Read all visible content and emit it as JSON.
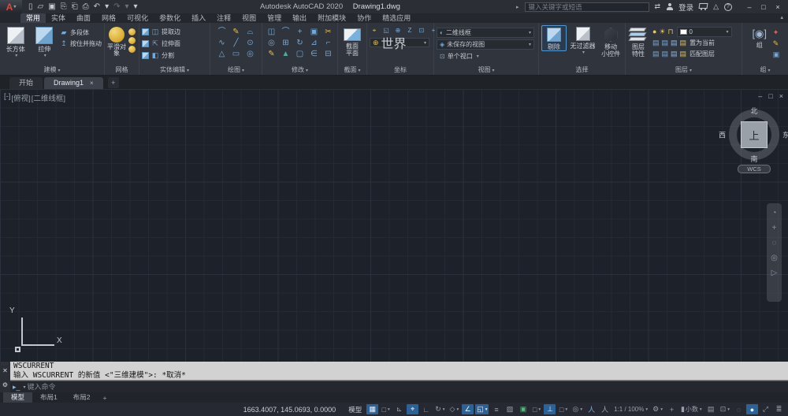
{
  "titlebar": {
    "logo_letter": "A",
    "app_title": "Autodesk AutoCAD 2020",
    "doc_title": "Drawing1.dwg",
    "search_expand": "▸",
    "search_placeholder": "键入关键字或短语",
    "exchange_glyph": "⇄",
    "signin_label": "登录",
    "triangle_glyph": "△",
    "help_glyph": "?",
    "win_min": "–",
    "win_max": "□",
    "win_close": "×",
    "qat": [
      {
        "name": "new",
        "glyph": "▯"
      },
      {
        "name": "open",
        "glyph": "▱"
      },
      {
        "name": "save",
        "glyph": "▣"
      },
      {
        "name": "save-as",
        "glyph": "⎘"
      },
      {
        "name": "plot-batch",
        "glyph": "⎗"
      },
      {
        "name": "plot",
        "glyph": "⎙"
      },
      {
        "name": "undo",
        "glyph": "↶"
      },
      {
        "name": "undo-dd",
        "glyph": "▾"
      },
      {
        "name": "redo",
        "glyph": "↷",
        "color": "#6b717b"
      },
      {
        "name": "redo-dd",
        "glyph": "▾",
        "color": "#6b717b"
      },
      {
        "name": "qat-customize",
        "glyph": "▾"
      }
    ]
  },
  "ribbon": {
    "tabs": [
      {
        "label": "常用",
        "active": true
      },
      {
        "label": "实体"
      },
      {
        "label": "曲面"
      },
      {
        "label": "网格"
      },
      {
        "label": "可视化"
      },
      {
        "label": "参数化"
      },
      {
        "label": "插入"
      },
      {
        "label": "注释"
      },
      {
        "label": "视图"
      },
      {
        "label": "管理"
      },
      {
        "label": "输出"
      },
      {
        "label": "附加模块"
      },
      {
        "label": "协作"
      },
      {
        "label": "精选应用"
      }
    ],
    "collapse_glyph": "▴"
  },
  "panels": {
    "modeling": {
      "label": "建模",
      "box": "长方体",
      "extrude": "拉伸",
      "polysolid": "多段体",
      "presspull": "按住并拖动"
    },
    "mesh": {
      "label": "网格",
      "smooth": "平滑对象"
    },
    "solid_edit": {
      "label": "实体编辑",
      "items": [
        {
          "glyph": "◫",
          "label": "提取边"
        },
        {
          "glyph": "⇱",
          "label": "拉伸面"
        },
        {
          "glyph": "◧",
          "label": "分割"
        }
      ]
    },
    "draw": {
      "label": "绘图",
      "icons": [
        {
          "name": "arc",
          "glyph": "⌒"
        },
        {
          "name": "pencil",
          "glyph": "✎",
          "color": "#e3bf4a"
        },
        {
          "name": "arc-chord",
          "glyph": "⌓"
        },
        {
          "name": "spline",
          "glyph": "∿"
        },
        {
          "name": "line",
          "glyph": "╱"
        },
        {
          "name": "circle",
          "glyph": "⊙"
        },
        {
          "name": "polygon",
          "glyph": "△"
        },
        {
          "name": "rectangle",
          "glyph": "▭"
        },
        {
          "name": "donut",
          "glyph": "◎"
        }
      ]
    },
    "modify": {
      "label": "修改",
      "icons": [
        {
          "name": "mirror",
          "glyph": "◫"
        },
        {
          "name": "fillet",
          "glyph": "⌒"
        },
        {
          "name": "move",
          "glyph": "+"
        },
        {
          "name": "copy",
          "glyph": "▣"
        },
        {
          "name": "trim",
          "glyph": "✂",
          "color": "#e3bf4a"
        },
        {
          "name": "offset",
          "glyph": "◎"
        },
        {
          "name": "array",
          "glyph": "⊞"
        },
        {
          "name": "rotate",
          "glyph": "↻"
        },
        {
          "name": "scale",
          "glyph": "⊿"
        },
        {
          "name": "stretch",
          "glyph": "⌐"
        },
        {
          "name": "erase",
          "glyph": "✎",
          "color": "#e3bf4a"
        },
        {
          "name": "explode",
          "glyph": "▲",
          "color": "#58a6a0"
        },
        {
          "name": "align",
          "glyph": "▢"
        },
        {
          "name": "join",
          "glyph": "∈"
        },
        {
          "name": "break",
          "glyph": "⊟"
        }
      ]
    },
    "section": {
      "label": "截面",
      "plane_line1": "截面",
      "plane_line2": "平面"
    },
    "coords": {
      "label": "坐标",
      "world": "世界",
      "icons": [
        {
          "name": "ucs",
          "glyph": "⌖",
          "color": "#e3bf4a"
        },
        {
          "name": "ucs-previous",
          "glyph": "◱"
        },
        {
          "name": "ucs-origin",
          "glyph": "⊕"
        },
        {
          "name": "ucs-z",
          "glyph": "Z"
        },
        {
          "name": "ucs-view",
          "glyph": "⊡"
        },
        {
          "name": "ucs-object",
          "glyph": "+"
        }
      ]
    },
    "view": {
      "label": "视图",
      "visual_style": "二维线框",
      "named_view": "未保存的视图",
      "viewport_cfg": "单个视口"
    },
    "selection": {
      "label": "选择",
      "cull": "剔除",
      "filter_line1": "无过滤器",
      "gizmo_line1": "移动",
      "gizmo_line2": "小控件"
    },
    "layers": {
      "label": "图层",
      "props_line1": "图层",
      "props_line2": "特性",
      "layer_name": "0",
      "set_current": "置为当前",
      "match": "匹配图层",
      "row1_icons": [
        {
          "name": "layer-on-bulb",
          "glyph": "●",
          "color": "#e8c94a"
        },
        {
          "name": "layer-thaw-sun",
          "glyph": "☀",
          "color": "#e8c94a"
        },
        {
          "name": "layer-unlock",
          "glyph": "⊓",
          "color": "#e8c94a"
        }
      ],
      "row2_icons": [
        {
          "name": "layer-off",
          "glyph": "▤",
          "color": "#74a9d8"
        },
        {
          "name": "layer-isolate",
          "glyph": "▤",
          "color": "#74a9d8"
        },
        {
          "name": "layer-freeze",
          "glyph": "▤",
          "color": "#8fb6dd"
        },
        {
          "name": "layer-lock",
          "glyph": "▤",
          "color": "#e3bf4a"
        }
      ],
      "row3_icons": [
        {
          "name": "layer-unisolate",
          "glyph": "▤",
          "color": "#74a9d8"
        },
        {
          "name": "layer-walk",
          "glyph": "▤",
          "color": "#74a9d8"
        },
        {
          "name": "layer-prev",
          "glyph": "▤",
          "color": "#8fb6dd"
        },
        {
          "name": "layer-merge",
          "glyph": "▤",
          "color": "#e3bf4a"
        }
      ]
    },
    "group": {
      "label": "组",
      "group": "组",
      "icons": [
        {
          "name": "ungroup",
          "glyph": "✦",
          "color": "#d06a6a"
        },
        {
          "name": "group-edit",
          "glyph": "✎",
          "color": "#e3bf4a"
        },
        {
          "name": "group-selection-toggle",
          "glyph": "▣",
          "color": "#74a9d8"
        }
      ]
    }
  },
  "file_tabs": {
    "start": "开始",
    "drawing": "Drawing1",
    "close": "×",
    "add": "+"
  },
  "viewport": {
    "label_parts": {
      "controls": "[-]",
      "view": "[俯视]",
      "style": "[二维线框]"
    },
    "win": {
      "min": "‒",
      "restore": "□",
      "close": "×"
    },
    "viewcube": {
      "n": "北",
      "s": "南",
      "e": "东",
      "w": "西",
      "top": "上",
      "wcs": "WCS"
    },
    "navbar_icons": [
      {
        "name": "steering-wheel",
        "glyph": "◔"
      },
      {
        "name": "pan",
        "glyph": "+"
      },
      {
        "name": "zoom",
        "glyph": "◌"
      },
      {
        "name": "orbit",
        "glyph": "◎"
      },
      {
        "name": "showmotion",
        "glyph": "▷"
      }
    ],
    "ucs": {
      "x": "X",
      "y": "Y"
    }
  },
  "command": {
    "line1": "WSCURRENT",
    "line2": "输入 WSCURRENT 的新值 <\"三维建模\">: *取消*",
    "placeholder": "键入命令",
    "close_glyph": "✕",
    "wrench_glyph": "⚙",
    "prompt_icon": "▸_"
  },
  "layout_tabs": {
    "items": [
      {
        "label": "模型",
        "active": true
      },
      {
        "label": "布局1"
      },
      {
        "label": "布局2"
      }
    ],
    "add": "+"
  },
  "statusbar": {
    "coords": "1663.4007, 145.0693, 0.0000",
    "model_label": "模型",
    "toggles": [
      {
        "name": "grid-display",
        "glyph": "▦",
        "active": true
      },
      {
        "name": "snap-mode",
        "glyph": "□",
        "dd": "▾"
      },
      {
        "name": "infer-constraints",
        "glyph": "⊾"
      },
      {
        "name": "dynamic-input",
        "glyph": "⌖",
        "active": true
      },
      {
        "name": "ortho-mode",
        "glyph": "∟"
      },
      {
        "name": "polar-tracking",
        "glyph": "↻",
        "dd": "▾"
      },
      {
        "name": "isometric-drafting",
        "glyph": "◇",
        "dd": "▾"
      },
      {
        "name": "osnap-tracking",
        "glyph": "∠",
        "active": true
      },
      {
        "name": "object-snap",
        "glyph": "◱",
        "active": true,
        "dd": "▾"
      },
      {
        "name": "lineweight",
        "glyph": "≡"
      },
      {
        "name": "transparency",
        "glyph": "▨"
      },
      {
        "name": "selection-cycling",
        "glyph": "▣",
        "color": "#56b87a"
      },
      {
        "name": "osnap-3d",
        "glyph": "□",
        "dd": "▾"
      },
      {
        "name": "dynamic-ucs",
        "glyph": "⊥",
        "active": true
      },
      {
        "name": "selection-filtering",
        "glyph": "□",
        "dd": "▾"
      },
      {
        "name": "gizmo",
        "glyph": "◎",
        "dd": "▾"
      },
      {
        "name": "annotation-visibility",
        "glyph": "人",
        "color": "#74a9d8"
      },
      {
        "name": "autoscale",
        "glyph": "人"
      },
      {
        "name": "annotation-scale",
        "label": "1:1 / 100%",
        "dd": "▾"
      },
      {
        "name": "workspace-switching",
        "glyph": "⚙",
        "dd": "▾"
      },
      {
        "name": "annotation-monitor",
        "glyph": "+"
      },
      {
        "name": "units",
        "glyph": "▮",
        "label": "小数",
        "dd": "▾"
      },
      {
        "name": "quick-properties",
        "glyph": "▤"
      },
      {
        "name": "lock-ui",
        "glyph": "⊡",
        "dd": "▾"
      },
      {
        "name": "isolate-objects",
        "glyph": "◌"
      },
      {
        "name": "graphics-performance",
        "glyph": "●",
        "active": true
      },
      {
        "name": "clean-screen",
        "glyph": "⤢"
      },
      {
        "name": "customization",
        "glyph": "≣"
      }
    ]
  },
  "colors": {
    "accent": "#2d6296",
    "canvas": "#1d2129",
    "command_bg": "#d2d2d2",
    "icon_blue": "#74a9d8",
    "icon_yellow": "#e3bf4a"
  }
}
